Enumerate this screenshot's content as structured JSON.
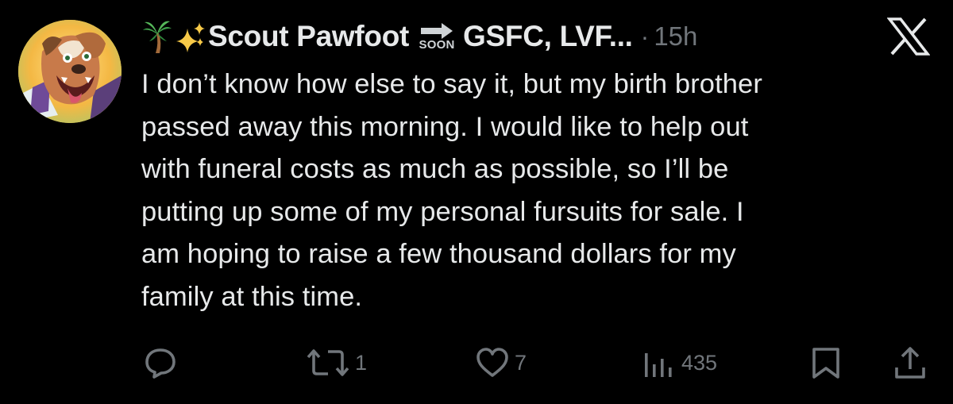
{
  "author": {
    "display_name": "Scout Pawfoot",
    "name_suffix": "GSFC, LVF...",
    "soon_label": "SOON",
    "emojis": [
      "palm-tree-icon",
      "sparkles-icon",
      "soon-arrow-icon"
    ]
  },
  "meta": {
    "separator": "·",
    "timestamp": "15h"
  },
  "tweet": {
    "text": "I don’t know how else to say it, but my birth brother\npassed away this morning. I would like to help out\nwith funeral costs as much as possible, so I’ll be\nputting up some of my personal fursuits for sale. I\nam hoping to raise a few thousand dollars for my\nfamily at this time."
  },
  "actions": {
    "reply": {
      "icon": "reply-icon",
      "count": ""
    },
    "repost": {
      "icon": "repost-icon",
      "count": "1"
    },
    "like": {
      "icon": "heart-icon",
      "count": "7"
    },
    "views": {
      "icon": "views-icon",
      "count": "435"
    },
    "bookmark": {
      "icon": "bookmark-icon"
    },
    "share": {
      "icon": "share-icon"
    }
  },
  "colors": {
    "background": "#000000",
    "text_primary": "#e7e9ea",
    "text_secondary": "#71767b"
  }
}
